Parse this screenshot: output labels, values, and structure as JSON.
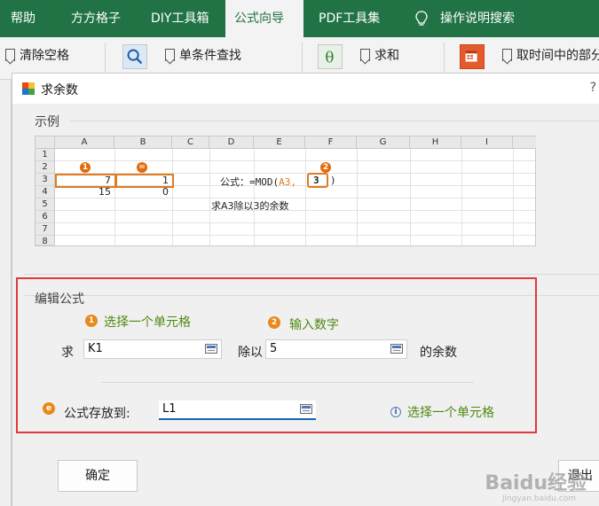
{
  "ribbon": {
    "tabs": [
      "帮助",
      "方方格子",
      "DIY工具箱",
      "公式向导",
      "PDF工具集",
      "操作说明搜索"
    ],
    "active_tab": "公式向导",
    "items": [
      "清除空格",
      "单条件查找",
      "求和",
      "取时间中的部分"
    ],
    "theme_color": "#217346"
  },
  "dialog": {
    "title": "求余数",
    "help": "?",
    "example": {
      "group_title": "示例",
      "columns": [
        "A",
        "B",
        "C",
        "D",
        "E",
        "F",
        "G",
        "H",
        "I"
      ],
      "rows": [
        "1",
        "2",
        "3",
        "4",
        "5",
        "6",
        "7",
        "8"
      ],
      "a3": "7",
      "b3": "1",
      "a4": "15",
      "b4": "0",
      "badge_a": "1",
      "badge_b": "=",
      "badge_f": "2",
      "formula_label": "公式：",
      "formula_prefix": "=MOD(",
      "formula_ref": "A3,",
      "formula_num": "3",
      "formula_suffix": ")",
      "note": "求A3除以3的余数"
    },
    "edit": {
      "group_title": "编辑公式",
      "hint_1": "选择一个单元格",
      "hint_2": "输入数字",
      "label_qiu": "求",
      "input_cell": "K1",
      "label_divide": "除以",
      "input_number": "5",
      "label_remainder": "的余数",
      "store_label": "公式存放到:",
      "store_value": "L1",
      "store_hint": "选择一个单元格"
    },
    "buttons": {
      "ok": "确定",
      "exit": "退出"
    }
  },
  "watermark": {
    "text": "Baidu经验",
    "sub": "jingyan.baidu.com"
  }
}
